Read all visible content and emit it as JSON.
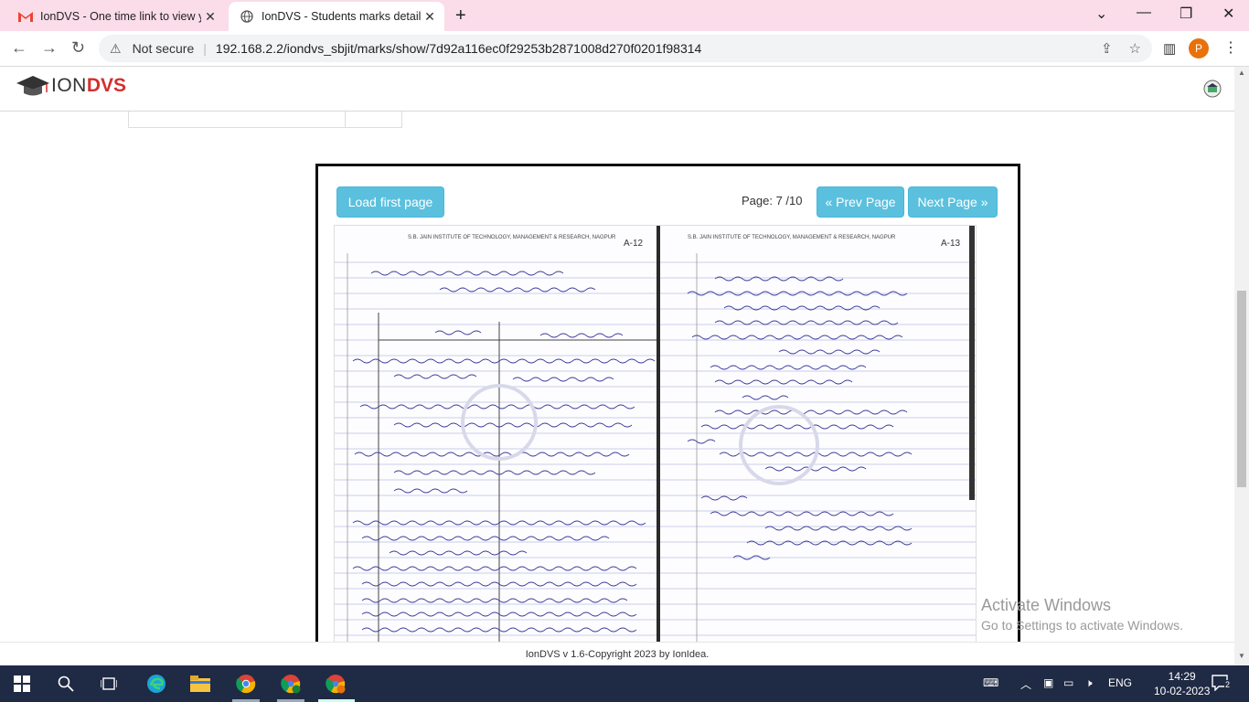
{
  "browser": {
    "tabs": [
      {
        "title": "IonDVS - One time link to view yo",
        "active": false,
        "favicon": "gmail-icon"
      },
      {
        "title": "IonDVS - Students marks details",
        "active": true,
        "favicon": "globe-icon"
      }
    ],
    "security_label": "Not secure",
    "url": "192.168.2.2/iondvs_sbjit/marks/show/7d92a116ec0f29253b2871008d270f0201f98314",
    "profile_initial": "P"
  },
  "app": {
    "logo_ion": "ION",
    "logo_dvs": "DVS"
  },
  "viewer": {
    "load_first_label": "Load first page",
    "page_info": "Page: 7 /10",
    "prev_label": "« Prev Page",
    "next_label": "Next Page »",
    "scan": {
      "left_page_number": "A-12",
      "right_page_number": "A-13",
      "header_text": "S.B. JAIN INSTITUTE OF TECHNOLOGY, MANAGEMENT & RESEARCH, NAGPUR"
    }
  },
  "footer": {
    "text": "IonDVS v 1.6-Copyright 2023 by IonIdea."
  },
  "watermark": {
    "line1": "Activate Windows",
    "line2": "Go to Settings to activate Windows."
  },
  "taskbar": {
    "language": "ENG",
    "time": "14:29",
    "date": "10-02-2023",
    "notification_count": "2"
  },
  "colors": {
    "tab_strip": "#fbdce9",
    "button_info": "#5bc0de",
    "logo_red": "#d32f2f",
    "taskbar": "#1f2a44",
    "profile": "#e8710a"
  }
}
